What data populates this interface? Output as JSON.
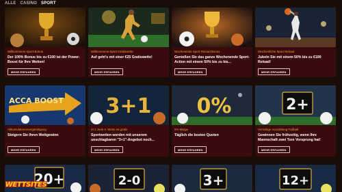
{
  "nav": {
    "tabs": [
      {
        "label": "ALLE",
        "active": false
      },
      {
        "label": "CASINO",
        "active": false
      },
      {
        "label": "SPORT",
        "active": true
      }
    ]
  },
  "cards": [
    {
      "category": "Willkommens-Sport-Bonus",
      "title": "Der 100% Bonus bis zu €100 ist der Power-Boost für Ihre Wetten!",
      "button": "MEHR ERFAHREN",
      "image": "trophy-stadium-image"
    },
    {
      "category": "Willkommens-Sport-Gratiswette",
      "title": "Auf geht's mit einer €25 Gratiswette!",
      "button": "MEHR ERFAHREN",
      "image": "footballer-kick-image"
    },
    {
      "category": "Wochenende Sport Reload Bonus",
      "title": "Genießen Sie das ganze Wochenende Sport-Action mit einem 50% bis zu bis...",
      "button": "MEHR ERFAHREN",
      "image": "trophy-balls-image"
    },
    {
      "category": "Wochentliche Sport Reload",
      "title": "Jubeln Sie mit einem 50% bis zu €100 Reload!",
      "button": "MEHR ERFAHREN",
      "image": "basketball-player-image"
    },
    {
      "category": "Akkumulatorenvergünstigung",
      "title": "Steigern Sie Ihren Wettgewinn",
      "button": "MEHR ERFAHREN",
      "image": "acca-boost-image",
      "image_text": "ACCA BOOST"
    },
    {
      "category": "3+1 Jede 4. Wette ist gratis",
      "title": "Sportwetten werden mit unserem unschlagbaren \"3+1\"-Angebot noch...",
      "button": "MEHR ERFAHREN",
      "image": "three-plus-one-image",
      "image_text": "3+1"
    },
    {
      "category": "0% Marge",
      "title": "Täglich die besten Quoten",
      "button": "MEHR ERFAHREN",
      "image": "zero-percent-image",
      "image_text": "0%"
    },
    {
      "category": "Vorzeitige Auszahlung Fußball",
      "title": "Gewinnen Sie frühzeitig, wenn Ihre Mannschaft zwei Tore Vorsprung hat!",
      "button": "MEHR ERFAHREN",
      "image": "two-plus-image",
      "image_text": "2+"
    },
    {
      "image": "twenty-plus-image",
      "image_text": "20+"
    },
    {
      "image": "two-zero-image",
      "image_text": "2-0"
    },
    {
      "image": "three-plus-image",
      "image_text": "3+"
    },
    {
      "image": "twelve-plus-image",
      "image_text": "12+"
    }
  ],
  "logo": {
    "text": "WETTSITES"
  },
  "colors": {
    "card_bg": "#3b0a0c",
    "category": "#f0a23a",
    "page_bg": "#1a0d08",
    "logo_fill": "#ffcf1d",
    "logo_outline": "#c2261a"
  }
}
